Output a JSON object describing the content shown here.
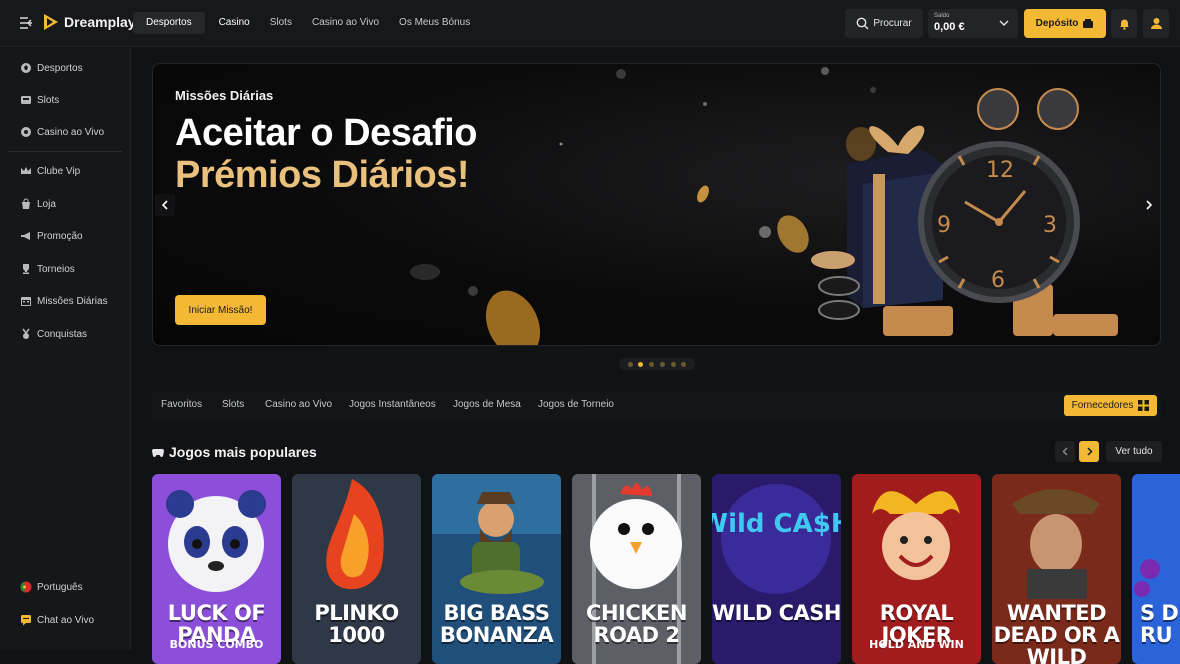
{
  "brand": {
    "name": "Dreamplay"
  },
  "top_nav": {
    "items": [
      {
        "label": "Desportos"
      },
      {
        "label": "Casino"
      },
      {
        "label": "Slots"
      },
      {
        "label": "Casino ao Vivo"
      },
      {
        "label": "Os Meus Bónus"
      }
    ],
    "active": "Casino"
  },
  "header": {
    "search_label": "Procurar",
    "balance_label": "Saldo",
    "balance_value": "0,00 €",
    "deposit_label": "Depósito"
  },
  "sidebar": {
    "items": [
      {
        "label": "Desportos",
        "icon": "sports-ball-icon"
      },
      {
        "label": "Slots",
        "icon": "slots-icon"
      },
      {
        "label": "Casino ao Vivo",
        "icon": "live-casino-icon"
      },
      {
        "label": "Clube Vip",
        "icon": "crown-icon"
      },
      {
        "label": "Loja",
        "icon": "shop-icon"
      },
      {
        "label": "Promoção",
        "icon": "megaphone-icon"
      },
      {
        "label": "Torneios",
        "icon": "trophy-icon"
      },
      {
        "label": "Missões Diárias",
        "icon": "calendar-icon"
      },
      {
        "label": "Conquistas",
        "icon": "medal-icon"
      }
    ],
    "footer": [
      {
        "label": "Português",
        "icon": "portugal-flag-icon"
      },
      {
        "label": "Chat ao Vivo",
        "icon": "chat-icon"
      }
    ]
  },
  "hero": {
    "kicker": "Missões Diárias",
    "headline": "Aceitar o Desafio",
    "subhead": "Prémios Diários!",
    "cta": "Iniciar Missão!",
    "slide_count": 6,
    "active_slide": 2,
    "clock_numbers": [
      "12",
      "3",
      "6",
      "9"
    ]
  },
  "categories": {
    "items": [
      "Favoritos",
      "Slots",
      "Casino ao Vivo",
      "Jogos Instantâneos",
      "Jogos de Mesa",
      "Jogos de Torneio"
    ],
    "providers_label": "Fornecedores"
  },
  "popular": {
    "title": "Jogos mais populares",
    "see_all": "Ver tudo",
    "games": [
      {
        "name": "LUCK OF PANDA",
        "sub": "BONUS COMBO"
      },
      {
        "name": "PLINKO 1000",
        "sub": ""
      },
      {
        "name": "BIG BASS BONANZA",
        "sub": ""
      },
      {
        "name": "CHICKEN ROAD 2",
        "sub": ""
      },
      {
        "name": "WILD CASH",
        "sub": ""
      },
      {
        "name": "ROYAL JOKER",
        "sub": "HOLD AND WIN"
      },
      {
        "name": "WANTED DEAD OR A WILD",
        "sub": ""
      },
      {
        "name": "S D RU",
        "sub": ""
      }
    ],
    "game_logos": {
      "wild_cash": "Wild CA$H"
    }
  },
  "colors": {
    "accent": "#f4b934",
    "gold_text": "#e9c07c",
    "background": "#111214"
  }
}
